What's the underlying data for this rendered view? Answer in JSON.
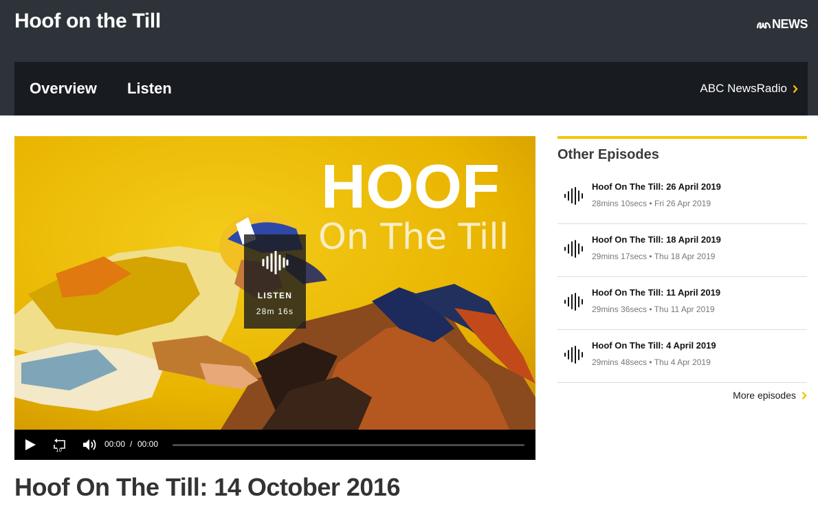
{
  "header": {
    "title": "Hoof on the Till",
    "brand": "NEWS",
    "brand_icon": "abc-logo-icon"
  },
  "nav": {
    "tabs": [
      {
        "label": "Overview"
      },
      {
        "label": "Listen"
      }
    ],
    "network_link": "ABC NewsRadio",
    "chevron_icon": "chevron-right-icon"
  },
  "player": {
    "art": {
      "headline": "HOOF",
      "subline": "On The Till"
    },
    "overlay": {
      "icon": "audio-wave-icon",
      "label": "LISTEN",
      "duration": "28m 16s"
    },
    "controls": {
      "play_icon": "play-icon",
      "rewind_icon": "rewind-10-icon",
      "volume_icon": "volume-icon",
      "current_time": "00:00",
      "separator": "/",
      "total_time": "00:00",
      "progress": 0
    }
  },
  "episode": {
    "title": "Hoof On The Till: 14 October 2016"
  },
  "sidebar": {
    "heading": "Other Episodes",
    "episodes": [
      {
        "title": "Hoof On The Till: 26 April 2019",
        "duration": "28mins 10secs",
        "date": "Fri 26 Apr 2019"
      },
      {
        "title": "Hoof On The Till: 18 April 2019",
        "duration": "29mins 17secs",
        "date": "Thu 18 Apr 2019"
      },
      {
        "title": "Hoof On The Till: 11 April 2019",
        "duration": "29mins 36secs",
        "date": "Thu 11 Apr 2019"
      },
      {
        "title": "Hoof On The Till: 4 April 2019",
        "duration": "29mins 48secs",
        "date": "Thu 4 Apr 2019"
      }
    ],
    "meta_separator": "•",
    "more_label": "More episodes"
  },
  "colors": {
    "header_bg": "#2e333a",
    "nav_bg": "#181b1f",
    "accent": "#f5c400",
    "art_yellow": "#f0c000"
  }
}
